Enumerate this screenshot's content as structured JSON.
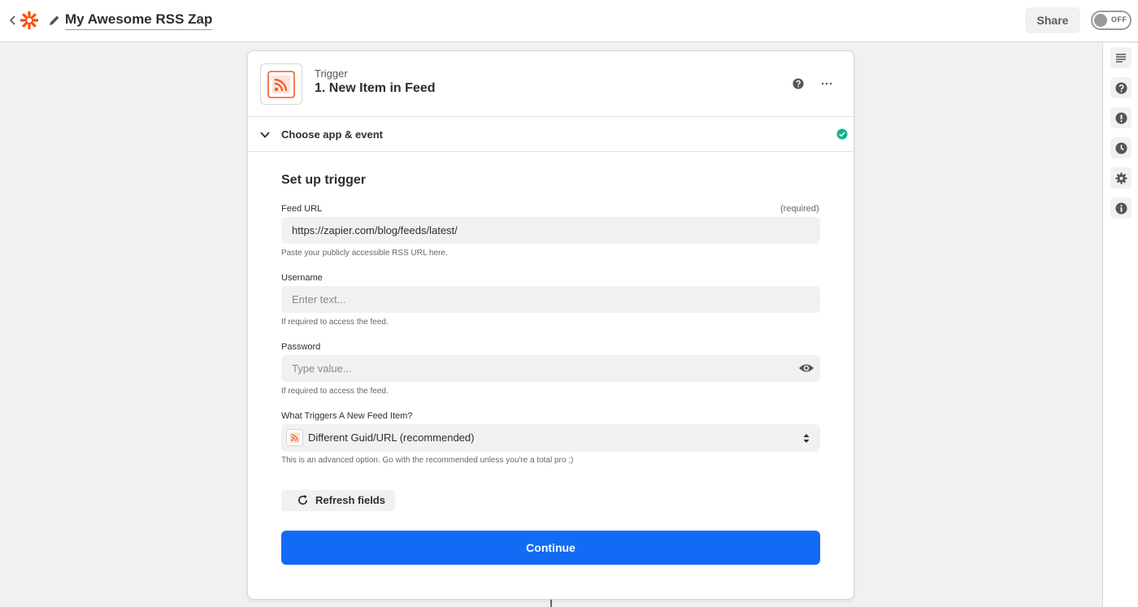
{
  "header": {
    "zap_title": "My Awesome RSS Zap",
    "share_label": "Share",
    "toggle_label": "OFF"
  },
  "step": {
    "kind_label": "Trigger",
    "title": "1. New Item in Feed",
    "section_label": "Choose app & event"
  },
  "form": {
    "title": "Set up trigger",
    "feed_url": {
      "label": "Feed URL",
      "required": "(required)",
      "value": "https://zapier.com/blog/feeds/latest/",
      "hint": "Paste your publicly accessible RSS URL here."
    },
    "username": {
      "label": "Username",
      "placeholder": "Enter text...",
      "hint": "If required to access the feed."
    },
    "password": {
      "label": "Password",
      "placeholder": "Type value...",
      "hint": "If required to access the feed."
    },
    "trigger_mode": {
      "label": "What Triggers A New Feed Item?",
      "selected": "Different Guid/URL (recommended)",
      "hint": "This is an advanced option. Go with the recommended unless you're a total pro ;)"
    },
    "refresh_label": "Refresh fields",
    "continue_label": "Continue"
  },
  "colors": {
    "brand_orange": "#ff4a00",
    "primary_blue": "#136bf5",
    "success_green": "#13b38b"
  },
  "icons": {
    "sidebar": [
      "outline-icon",
      "help-icon",
      "alert-icon",
      "history-icon",
      "settings-icon",
      "info-icon"
    ]
  }
}
